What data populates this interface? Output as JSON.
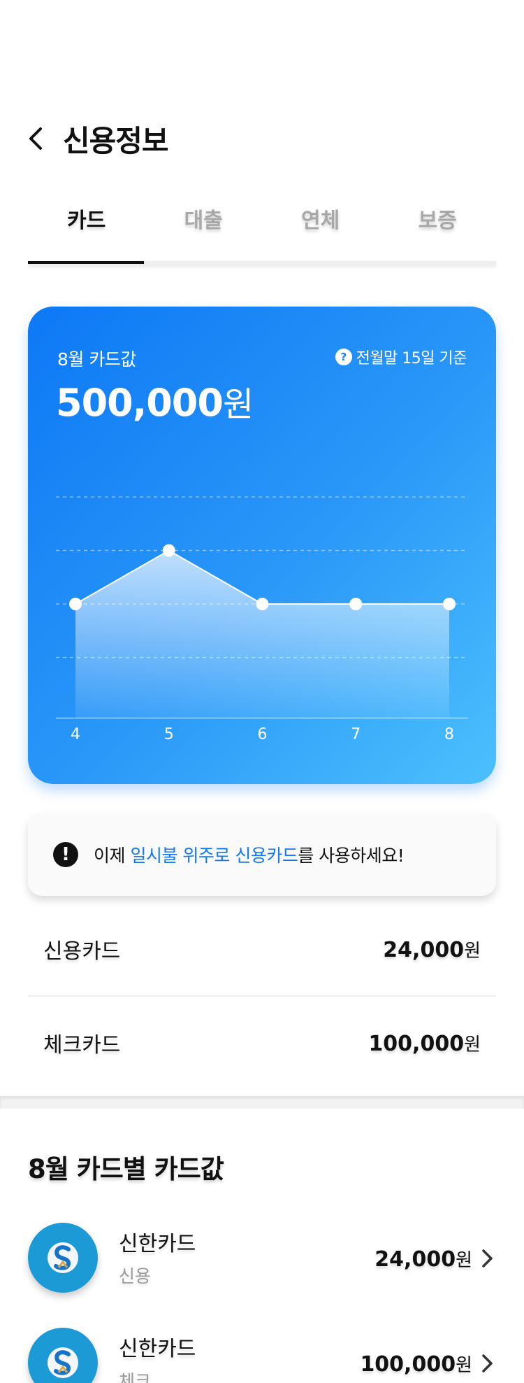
{
  "header": {
    "title": "신용정보"
  },
  "tabs": [
    {
      "label": "카드",
      "active": true
    },
    {
      "label": "대출",
      "active": false
    },
    {
      "label": "연체",
      "active": false
    },
    {
      "label": "보증",
      "active": false
    }
  ],
  "summary": {
    "label": "8월 카드값",
    "amount": "500,000",
    "unit": "원",
    "basis": "전월말 15일 기준"
  },
  "chart_data": {
    "type": "area",
    "categories": [
      "4",
      "5",
      "6",
      "7",
      "8"
    ],
    "values": [
      2,
      3,
      2,
      2,
      2
    ],
    "ylim": [
      0,
      4
    ],
    "grid": true,
    "line_color": "#ffffff"
  },
  "notice": {
    "prefix": "이제 ",
    "highlight": "일시불 위주로 신용카드",
    "suffix": "를 사용하세요!",
    "highlight_color": "#1278f2"
  },
  "totals": [
    {
      "label": "신용카드",
      "amount": "24,000",
      "unit": "원"
    },
    {
      "label": "체크카드",
      "amount": "100,000",
      "unit": "원"
    }
  ],
  "section": {
    "title": "8월 카드별 카드값"
  },
  "cards": [
    {
      "name": "신한카드",
      "type": "신용",
      "amount": "24,000",
      "unit": "원",
      "logo": "shinhan-logo-icon"
    },
    {
      "name": "신한카드",
      "type": "체크",
      "amount": "100,000",
      "unit": "원",
      "logo": "shinhan-logo-icon"
    }
  ],
  "colors": {
    "accent": "#1278f2",
    "card_gradient_start": "#0d78f5",
    "card_gradient_end": "#4cc0fd"
  }
}
